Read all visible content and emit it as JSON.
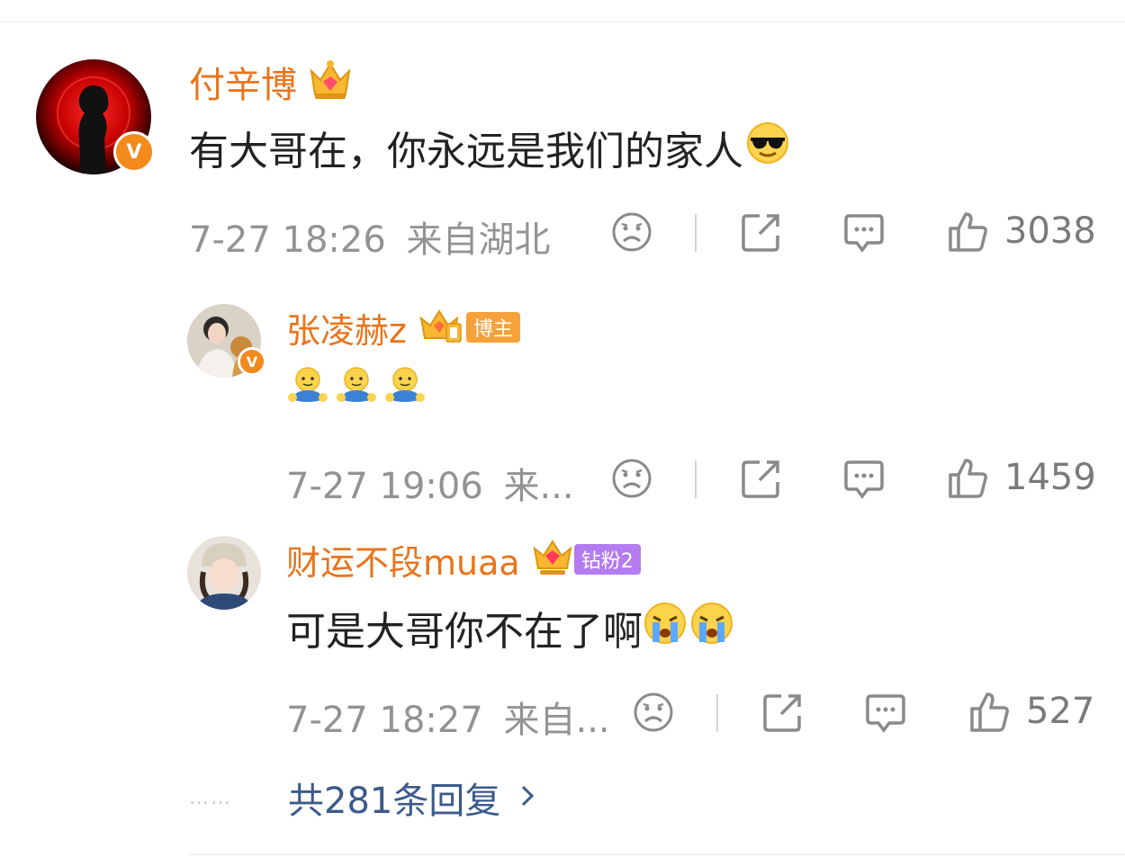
{
  "colors": {
    "username": "#e8741c",
    "meta": "#939393",
    "link": "#3c5a8a",
    "badge": "#f28a1c"
  },
  "comments": [
    {
      "username": "付辛博",
      "avatar_icon": "silhouette-avatar",
      "verified": "V",
      "crown_icon": "gold-crown-icon",
      "text": "有大哥在，你永远是我们的家人",
      "emoji": [
        "sunglasses-emoji"
      ],
      "date": "7-27 18:26",
      "location": "来自湖北",
      "likes": "3038"
    },
    {
      "username": "张凌赫z",
      "avatar_icon": "person-with-dog-avatar",
      "verified": "V",
      "crown_icon": "gold-crown-icon",
      "tag": "博主",
      "text": "",
      "emoji": [
        "hug-emoji",
        "hug-emoji",
        "hug-emoji"
      ],
      "date": "7-27 19:06",
      "location": "来...",
      "likes": "1459"
    },
    {
      "username": "财运不段muaa",
      "avatar_icon": "girl-beanie-avatar",
      "crown_icon": "diamond-crown-icon",
      "tag": "钻粉2",
      "text": "可是大哥你不在了啊",
      "emoji": [
        "crying-emoji",
        "crying-emoji"
      ],
      "date": "7-27 18:27",
      "location": "来自...",
      "likes": "527"
    }
  ],
  "replies": {
    "dots": "……",
    "label": "共281条回复"
  }
}
